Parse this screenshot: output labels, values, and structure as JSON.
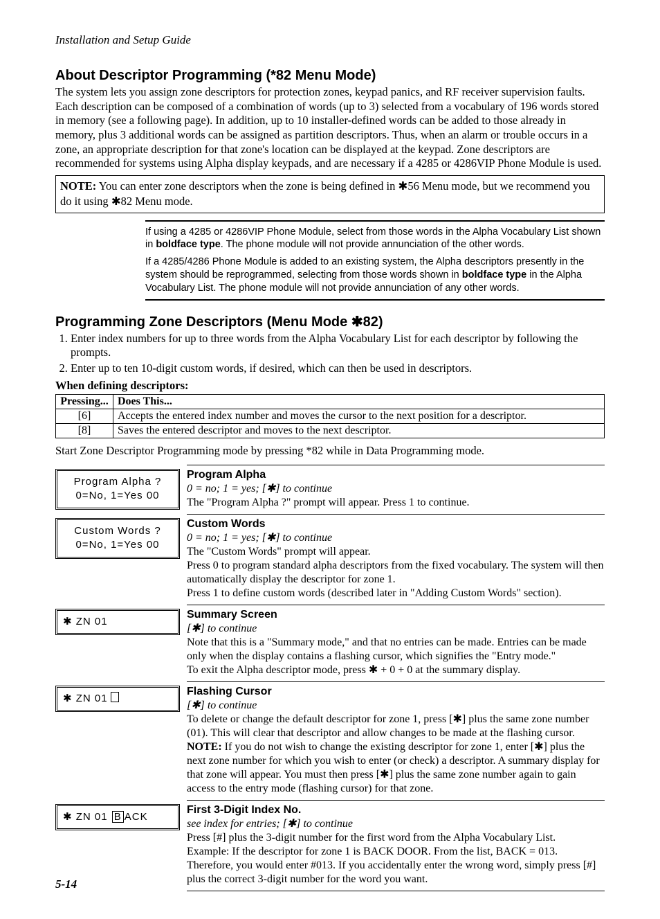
{
  "running_head": "Installation and Setup Guide",
  "section1": {
    "title": "About Descriptor Programming (*82 Menu Mode)",
    "para": "The system lets you assign zone descriptors for protection zones, keypad panics, and RF receiver supervision faults. Each description can be composed of a combination of words (up to 3) selected from a vocabulary of 196 words stored in memory (see a following page). In addition, up to 10 installer-defined words can be added to those already in memory, plus 3 additional words can be assigned as partition descriptors. Thus, when an alarm or trouble occurs in a zone, an appropriate description for that zone's location can be displayed at the keypad. Zone descriptors are recommended for systems using Alpha display keypads, and are necessary if a 4285 or 4286VIP Phone Module is used."
  },
  "note": {
    "label": "NOTE:",
    "text_a": " You can enter zone descriptors when the zone is being defined in ",
    "star": "✱",
    "text_b": "56 Menu mode, but we recommend you do it using ",
    "text_c": "82 Menu mode."
  },
  "inset": {
    "p1a": "If using a 4285 or 4286VIP Phone Module, select from those words in the Alpha Vocabulary List shown in ",
    "p1bold": "boldface type",
    "p1b": ". The phone module will not provide annunciation of the other words.",
    "p2a": "If a 4285/4286 Phone Module is added to an existing system, the Alpha descriptors presently in the system should be reprogrammed, selecting from those words shown in ",
    "p2bold": "boldface type",
    "p2b": " in the Alpha Vocabulary List. The phone module will not provide annunciation of any other words."
  },
  "section2": {
    "title": "Programming Zone Descriptors (Menu Mode ✱82)",
    "steps": [
      "Enter index numbers for up to three words from the Alpha Vocabulary List for each descriptor by following the prompts.",
      "Enter up to ten 10-digit custom words, if desired, which can then be used in descriptors."
    ],
    "subhead": "When defining descriptors:"
  },
  "press_table": {
    "h1": "Pressing...",
    "h2": "Does This...",
    "rows": [
      {
        "key": "[6]",
        "does": "Accepts the entered index number and moves the cursor to the next position for a descriptor."
      },
      {
        "key": "[8]",
        "does": "Saves the entered descriptor and moves to the next descriptor."
      }
    ]
  },
  "after_table": "Start Zone Descriptor Programming mode by pressing *82 while in Data Programming mode.",
  "prompts": [
    {
      "lcd_lines": [
        "Program Alpha ?",
        "0=No, 1=Yes  00"
      ],
      "lcd_center": true,
      "title": "Program Alpha",
      "sub": "0 = no; 1 = yes; [✱] to continue",
      "body": [
        "The \"Program Alpha ?\" prompt will appear. Press 1 to continue."
      ]
    },
    {
      "lcd_lines": [
        "Custom Words ?",
        "0=No, 1=Yes  00"
      ],
      "lcd_center": true,
      "title": "Custom Words",
      "sub": "0 = no; 1 = yes; [✱] to continue",
      "body": [
        "The \"Custom Words\" prompt will appear.",
        "Press 0 to program standard alpha descriptors from the fixed vocabulary. The system will then automatically display the descriptor for zone 1.",
        "Press 1 to define custom words (described later in \"Adding Custom Words\" section)."
      ]
    },
    {
      "lcd_raw": "✱ ZN 01",
      "title": "Summary Screen",
      "sub": "[✱] to continue",
      "body": [
        "Note that this is a \"Summary mode,\" and that no entries can be made. Entries can be made only when the display contains a flashing cursor, which signifies the \"Entry mode.\"",
        "To exit the Alpha descriptor mode, press ✱ + 0 + 0 at the summary display."
      ]
    },
    {
      "lcd_raw_cursor": "✱ ZN 01",
      "title": "Flashing Cursor",
      "sub": "[✱] to continue",
      "body": [
        "To delete or change the default descriptor for zone 1, press [✱] plus the same zone number (01). This will clear that descriptor and allow changes to be made at the flashing cursor."
      ],
      "note_label": "NOTE:",
      "note_body": " If you do not wish to change the existing descriptor for zone 1, enter [✱] plus the next zone number for which you wish to enter (or check) a descriptor. A summary display for that zone will appear. You must then press [✱] plus the same zone number again to gain access to the entry mode (flashing cursor) for that zone."
    },
    {
      "lcd_boxed": {
        "prefix": "✱ ZN 01 ",
        "boxed": "B",
        "suffix": "ACK"
      },
      "title": "First 3-Digit Index No.",
      "sub": "see index for entries; [✱] to continue",
      "body": [
        "Press [#] plus the 3-digit number for the first word from the Alpha Vocabulary List.",
        "Example: If the descriptor for zone 1 is BACK DOOR. From the list, BACK = 013.",
        "Therefore, you would enter #013. If you accidentally enter the wrong word, simply press [#] plus the correct 3-digit number for the word you want."
      ]
    }
  ],
  "page_num": "5-14"
}
